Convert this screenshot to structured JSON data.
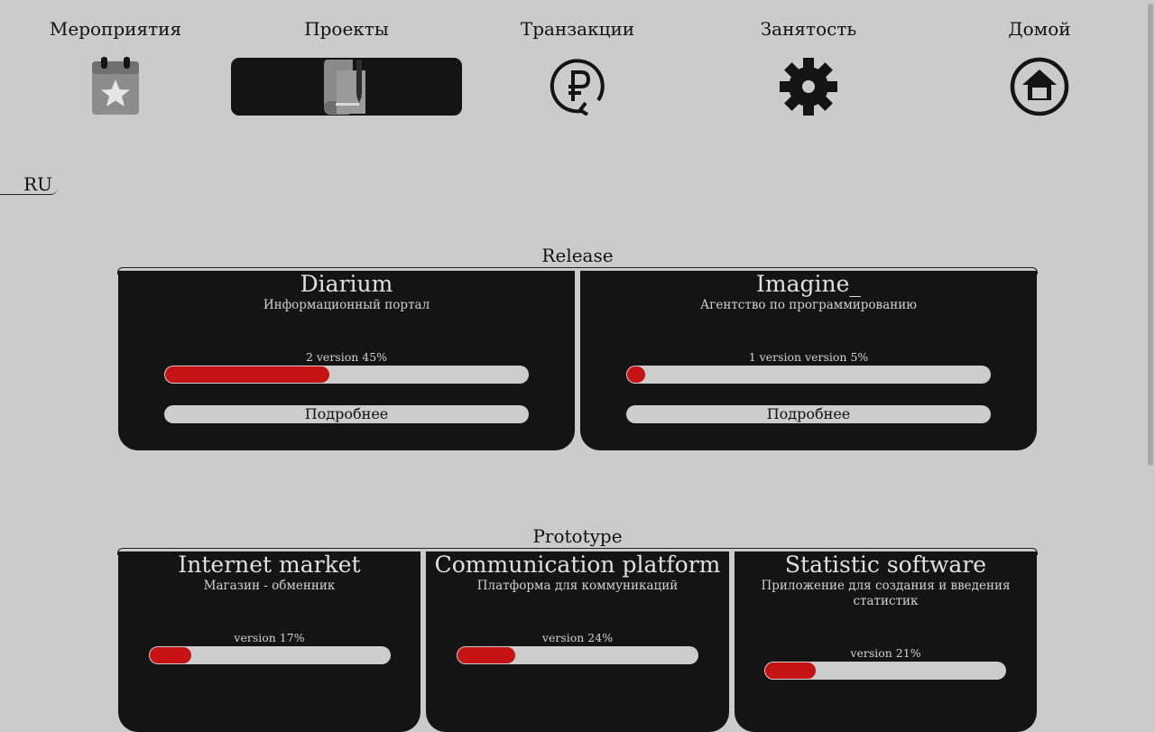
{
  "nav": {
    "items": [
      {
        "label": "Мероприятия",
        "icon": "calendar-star-icon",
        "active": false
      },
      {
        "label": "Проекты",
        "icon": "scroll-pen-icon",
        "active": true
      },
      {
        "label": "Транзакции",
        "icon": "ruble-refresh-icon",
        "active": false
      },
      {
        "label": "Занятость",
        "icon": "gear-icon",
        "active": false
      },
      {
        "label": "Домой",
        "icon": "home-icon",
        "active": false
      }
    ]
  },
  "language": {
    "label": "RU"
  },
  "colors": {
    "background": "#cbcbcb",
    "card": "#141414",
    "progress": "#c61212",
    "track": "#cdcdcd"
  },
  "release": {
    "title": "Release",
    "cards": [
      {
        "title": "Diarium",
        "subtitle": "Информационный портал",
        "version_label": "2 version 45%",
        "progress": 0.45,
        "more_label": "Подробнее"
      },
      {
        "title": "Imagine_",
        "subtitle": "Агентство по программированию",
        "version_label": "1 version version 5%",
        "progress": 0.05,
        "more_label": "Подробнее"
      }
    ]
  },
  "prototype": {
    "title": "Prototype",
    "cards": [
      {
        "title": "Internet market",
        "subtitle": "Магазин - обменник",
        "version_label": "version 17%",
        "progress": 0.17
      },
      {
        "title": "Communication platform",
        "subtitle": "Платформа для коммуникаций",
        "version_label": "version 24%",
        "progress": 0.24
      },
      {
        "title": "Statistic software",
        "subtitle": "Приложение для создания и введения статистик",
        "version_label": "version 21%",
        "progress": 0.21
      }
    ]
  }
}
